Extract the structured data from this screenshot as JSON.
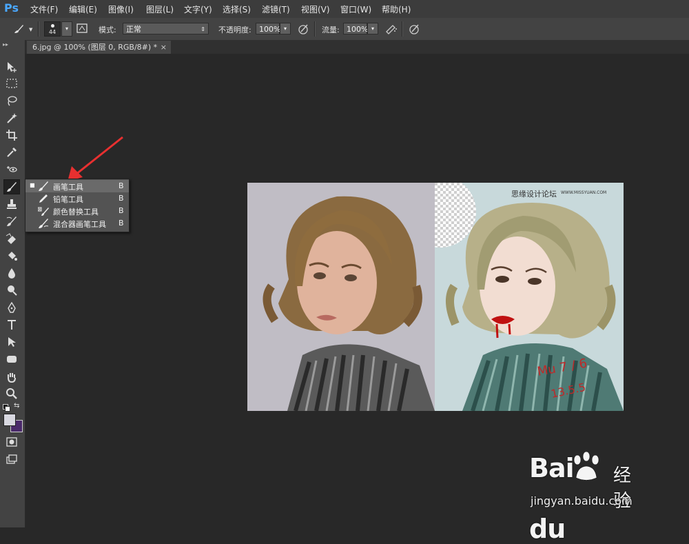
{
  "app": {
    "logo": "Ps"
  },
  "menu": [
    "文件(F)",
    "编辑(E)",
    "图像(I)",
    "图层(L)",
    "文字(Y)",
    "选择(S)",
    "滤镜(T)",
    "视图(V)",
    "窗口(W)",
    "帮助(H)"
  ],
  "options": {
    "brush_size": "44",
    "mode_label": "模式:",
    "mode_value": "正常",
    "opacity_label": "不透明度:",
    "opacity_value": "100%",
    "flow_label": "流量:",
    "flow_value": "100%"
  },
  "document": {
    "tab_title": "6.jpg @ 100% (图层 0, RGB/8#) *",
    "close": "×"
  },
  "toolbar": {
    "collapse": "▸▸"
  },
  "flyout": {
    "items": [
      {
        "label": "画笔工具",
        "key": "B",
        "selected": true
      },
      {
        "label": "铅笔工具",
        "key": "B",
        "selected": false
      },
      {
        "label": "颜色替换工具",
        "key": "B",
        "selected": false
      },
      {
        "label": "混合器画笔工具",
        "key": "B",
        "selected": false
      }
    ],
    "bullet": "■"
  },
  "image": {
    "watermark_cn": "思缘设计论坛",
    "watermark_en": "WWW.MISSYUAN.COM"
  },
  "colors": {
    "foreground": "#d8d8e0",
    "background": "#4a2a6a",
    "arrow": "#e83030",
    "blood": "#c01010"
  },
  "watermark": {
    "brand": "Bai",
    "brand2": "du",
    "cn": "经验",
    "url": "jingyan.baidu.com"
  }
}
